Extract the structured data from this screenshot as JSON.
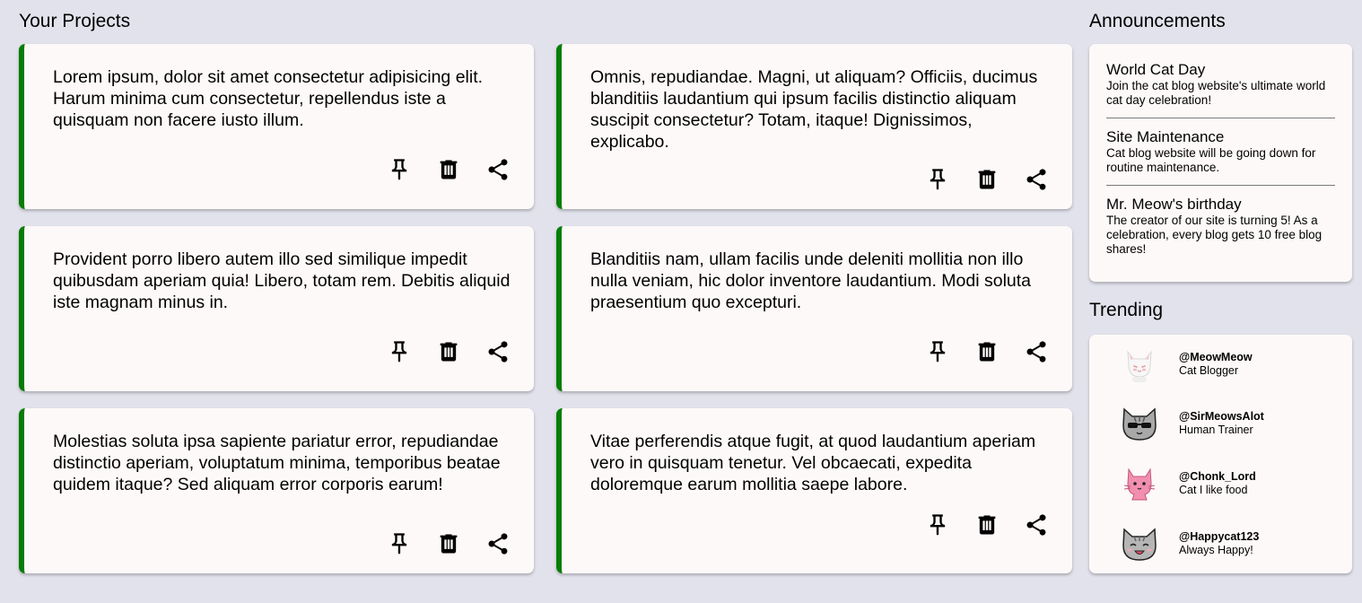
{
  "projects": {
    "title": "Your Projects",
    "cards": [
      {
        "text": "Lorem ipsum, dolor sit amet consectetur adipisicing elit. Harum minima cum consectetur, repellendus iste a quisquam non facere iusto illum."
      },
      {
        "text": "Omnis, repudiandae. Magni, ut aliquam? Officiis, ducimus blanditiis laudantium qui ipsum facilis distinctio aliquam suscipit consectetur? Totam, itaque! Dignissimos, explicabo."
      },
      {
        "text": "Provident porro libero autem illo sed similique impedit quibusdam aperiam quia! Libero, totam rem. Debitis aliquid iste magnam minus in."
      },
      {
        "text": "Blanditiis nam, ullam facilis unde deleniti mollitia non illo nulla veniam, hic dolor inventore laudantium. Modi soluta praesentium quo excepturi."
      },
      {
        "text": "Molestias soluta ipsa sapiente pariatur error, repudiandae distinctio aperiam, voluptatum minima, temporibus beatae quidem itaque? Sed aliquam error corporis earum!"
      },
      {
        "text": "Vitae perferendis atque fugit, at quod laudantium aperiam vero in quisquam tenetur. Vel obcaecati, expedita doloremque earum mollitia saepe labore."
      }
    ],
    "actions": {
      "pin_icon": "pushpin-icon",
      "delete_icon": "trash-icon",
      "share_icon": "share-icon"
    },
    "accent_color": "#067d06"
  },
  "announcements": {
    "title": "Announcements",
    "items": [
      {
        "title": "World Cat Day",
        "body": "Join the cat blog website's ultimate world cat day celebration!"
      },
      {
        "title": "Site Maintenance",
        "body": "Cat blog website will be going down for routine maintenance."
      },
      {
        "title": "Mr. Meow's birthday",
        "body": "The creator of our site is turning 5! As a celebration, every blog gets 10 free blog shares!"
      }
    ]
  },
  "trending": {
    "title": "Trending",
    "users": [
      {
        "handle": "@MeowMeow",
        "role": "Cat Blogger",
        "avatar": "white-cat-avatar"
      },
      {
        "handle": "@SirMeowsAlot",
        "role": "Human Trainer",
        "avatar": "sunglasses-cat-avatar"
      },
      {
        "handle": "@Chonk_Lord",
        "role": "Cat I like food",
        "avatar": "pink-cat-avatar"
      },
      {
        "handle": "@Happycat123",
        "role": "Always Happy!",
        "avatar": "gray-cat-avatar"
      }
    ]
  },
  "background_color": "#e2e2ec",
  "card_color": "#fdf9f8"
}
